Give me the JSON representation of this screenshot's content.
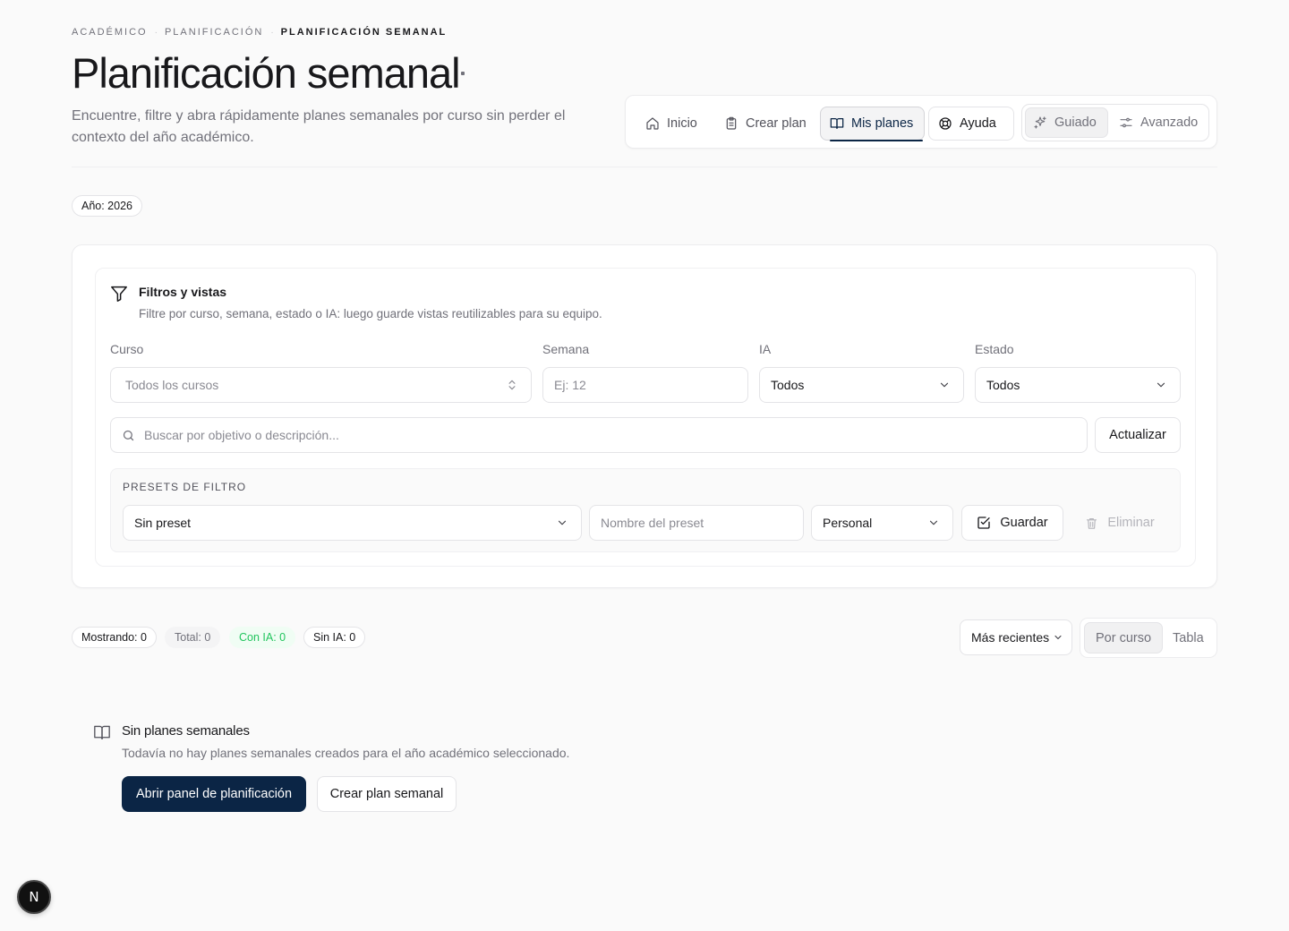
{
  "breadcrumb": {
    "items": [
      "Académico",
      "Planificación"
    ],
    "current": "Planificación semanal",
    "separator": "·"
  },
  "header": {
    "title": "Planificación semanal",
    "subtitle": "Encuentre, filtre y abra rápidamente planes semanales por curso sin perder el contexto del año académico."
  },
  "nav": {
    "items": [
      {
        "label": "Inicio",
        "icon": "home-icon"
      },
      {
        "label": "Crear plan",
        "icon": "clipboard-icon"
      },
      {
        "label": "Mis planes",
        "icon": "book-open-icon",
        "active": true
      },
      {
        "label": "Ayuda",
        "icon": "lifebuoy-icon"
      }
    ],
    "modes": [
      {
        "label": "Guiado",
        "icon": "sparkles-icon",
        "active": true
      },
      {
        "label": "Avanzado",
        "icon": "sliders-icon"
      }
    ]
  },
  "year_badge": "Año: 2026",
  "filters": {
    "title": "Filtros y vistas",
    "description": "Filtre por curso, semana, estado o IA: luego guarde vistas reutilizables para su equipo.",
    "course": {
      "label": "Curso",
      "placeholder": "Todos los cursos"
    },
    "week": {
      "label": "Semana",
      "placeholder": "Ej: 12"
    },
    "ai": {
      "label": "IA",
      "value": "Todos"
    },
    "status": {
      "label": "Estado",
      "value": "Todos"
    },
    "search": {
      "placeholder": "Buscar por objetivo o descripción..."
    },
    "refresh_label": "Actualizar"
  },
  "presets": {
    "label": "Presets de filtro",
    "select_value": "Sin preset",
    "name_placeholder": "Nombre del preset",
    "scope_value": "Personal",
    "save_label": "Guardar",
    "delete_label": "Eliminar"
  },
  "stats": {
    "showing": "Mostrando: 0",
    "total": "Total: 0",
    "with_ai": "Con IA: 0",
    "without_ai": "Sin IA: 0"
  },
  "sort": {
    "value": "Más recientes"
  },
  "view": {
    "options": [
      "Por curso",
      "Tabla"
    ],
    "active": "Por curso"
  },
  "empty": {
    "title": "Sin planes semanales",
    "description": "Todavía no hay planes semanales creados para el año académico seleccionado.",
    "primary_label": "Abrir panel de planificación",
    "secondary_label": "Crear plan semanal"
  },
  "badge": {
    "letter": "N"
  },
  "colors": {
    "primary": "#0b2545",
    "with_ai_text": "#22c55e",
    "with_ai_bg": "#f0fdf4"
  }
}
